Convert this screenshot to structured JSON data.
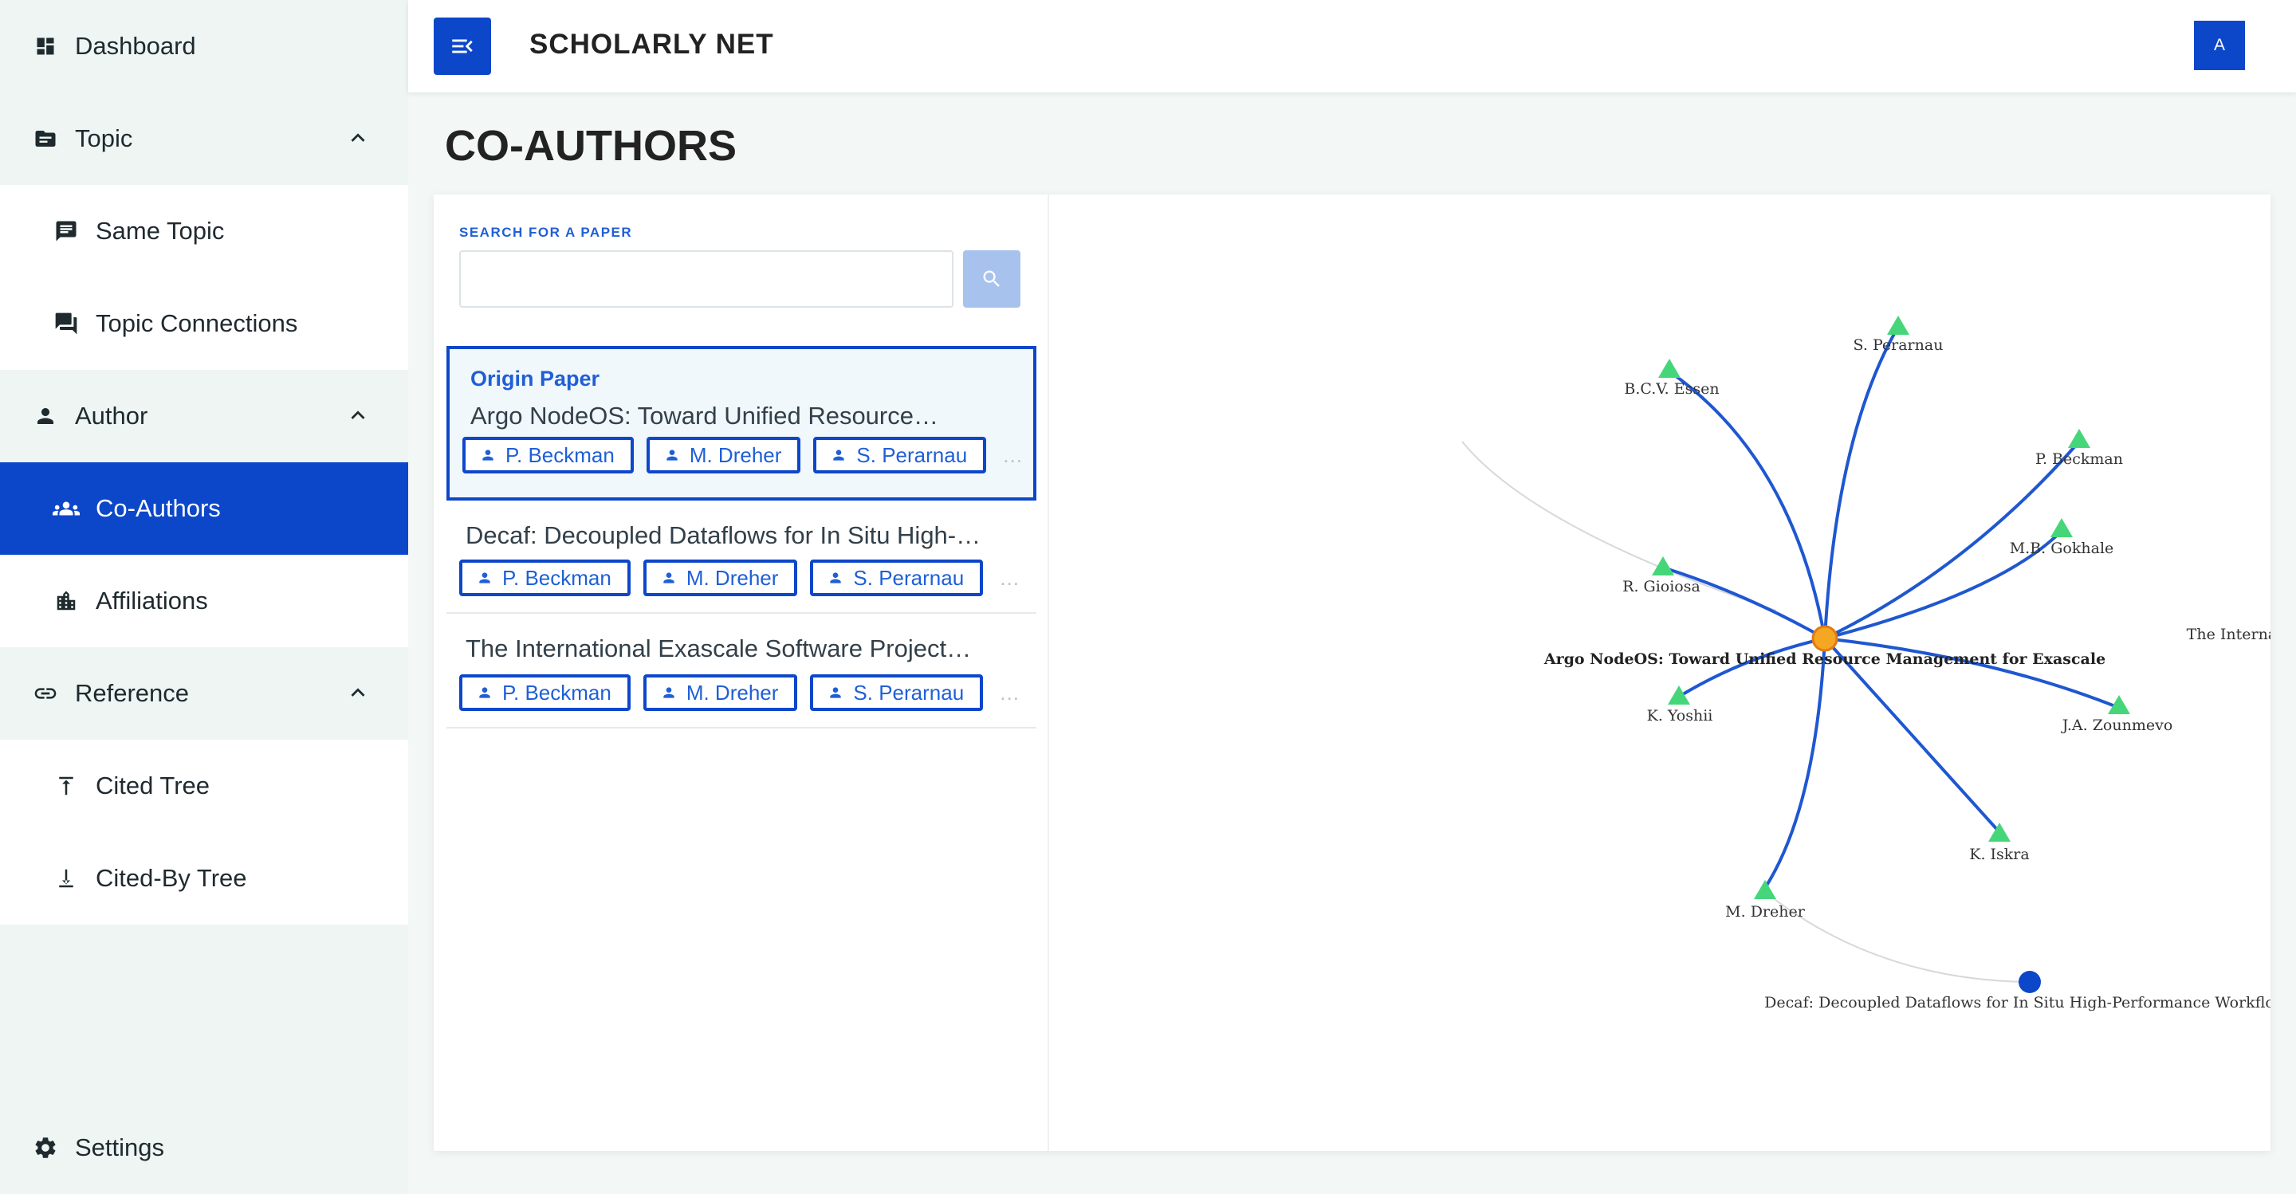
{
  "sidebar": {
    "dashboard": "Dashboard",
    "topic": "Topic",
    "same_topic": "Same Topic",
    "topic_connections": "Topic Connections",
    "author": "Author",
    "co_authors": "Co-Authors",
    "affiliations": "Affiliations",
    "reference": "Reference",
    "cited_tree": "Cited Tree",
    "cited_by_tree": "Cited-By Tree",
    "settings": "Settings"
  },
  "header": {
    "brand": "SCHOLARLY NET",
    "avatar_initial": "A"
  },
  "page": {
    "title": "CO-AUTHORS"
  },
  "search": {
    "label": "SEARCH FOR A PAPER",
    "value": ""
  },
  "papers": [
    {
      "tag": "Origin Paper",
      "title": "Argo NodeOS: Toward Unified Resource…",
      "authors": [
        "P. Beckman",
        "M. Dreher",
        "S. Perarnau"
      ],
      "more": "…"
    },
    {
      "title": "Decaf: Decoupled Dataflows for In Situ High-…",
      "authors": [
        "P. Beckman",
        "M. Dreher",
        "S. Perarnau"
      ],
      "more": "…"
    },
    {
      "title": "The International Exascale Software Project…",
      "authors": [
        "P. Beckman",
        "M. Dreher",
        "S. Perarnau"
      ],
      "more": "…"
    }
  ],
  "graph": {
    "center": "Argo NodeOS: Toward Unified Resource Management for Exascale",
    "authors": [
      "S. Perarnau",
      "B.C.V. Essen",
      "P. Beckman",
      "M.B. Gokhale",
      "R. Gioiosa",
      "K. Yoshii",
      "J.A. Zounmevo",
      "K. Iskra",
      "M. Dreher"
    ],
    "papers": [
      "The International Exascale Software Project roadmap",
      "Decaf: Decoupled Dataflows for In Situ High-Performance Workflows"
    ],
    "colors": {
      "edge": "#1f57d1",
      "author_node": "#46d67a",
      "paper_node": "#0d47c9",
      "center_node": "#f5a623"
    }
  }
}
